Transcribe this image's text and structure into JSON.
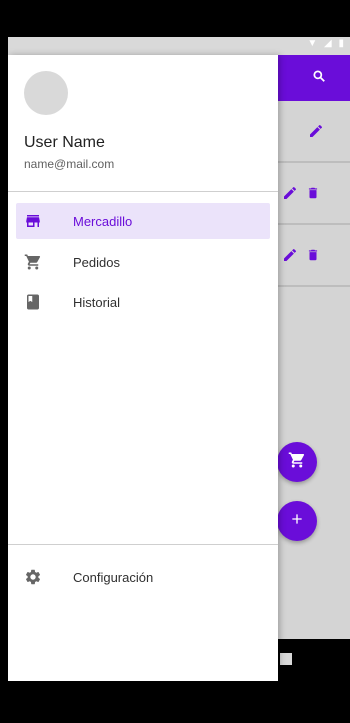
{
  "colors": {
    "primary": "#6a0dd9",
    "selected_bg": "#ebe3fa",
    "scrim_bg": "#d4d4d4"
  },
  "drawer": {
    "user_name": "User Name",
    "user_email": "name@mail.com",
    "items": [
      {
        "label": "Mercadillo",
        "icon": "store-icon",
        "active": true
      },
      {
        "label": "Pedidos",
        "icon": "cart-icon",
        "active": false
      },
      {
        "label": "Historial",
        "icon": "book-icon",
        "active": false
      }
    ],
    "footer_item": {
      "label": "Configuración",
      "icon": "gear-icon"
    }
  },
  "app": {
    "appbar_icon": "search-icon",
    "rows": [
      {
        "icons": [
          "edit-icon"
        ]
      },
      {
        "icons": [
          "edit-icon",
          "delete-icon"
        ]
      },
      {
        "icons": [
          "edit-icon",
          "delete-icon"
        ]
      }
    ],
    "fabs": [
      "cart-fab",
      "add-fab"
    ]
  }
}
